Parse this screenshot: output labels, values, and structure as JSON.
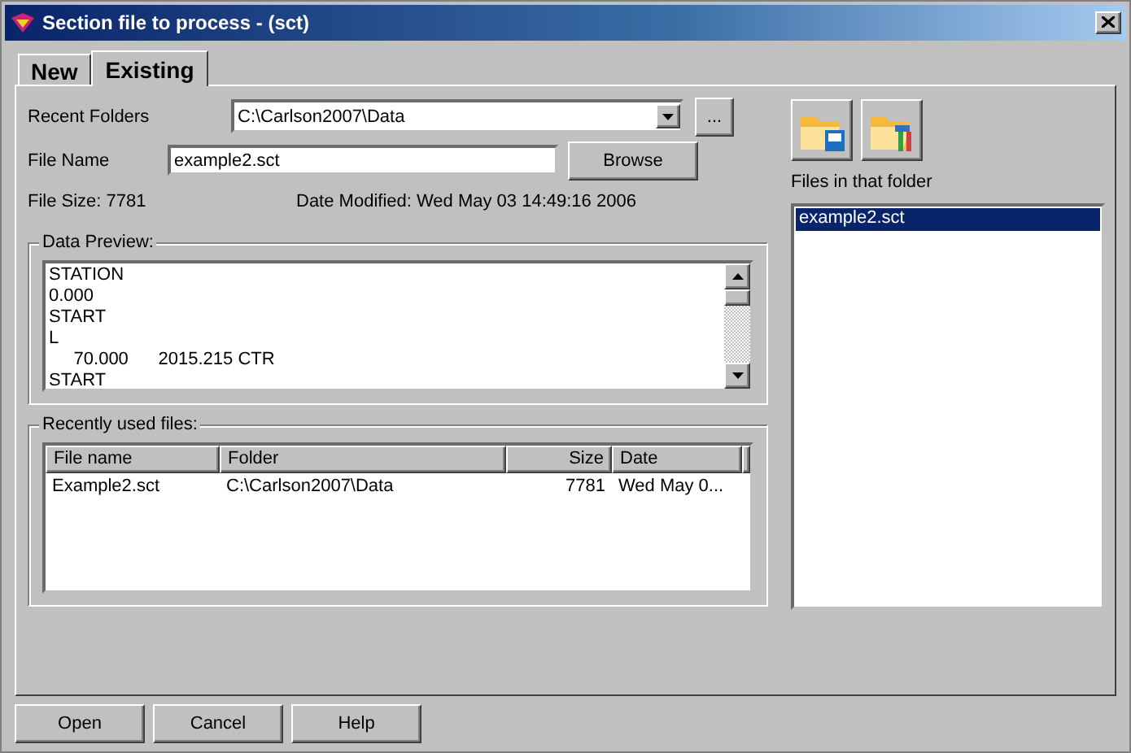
{
  "window": {
    "title": "Section file to process - (sct)"
  },
  "tabs": [
    {
      "label": "New",
      "selected": false
    },
    {
      "label": "Existing",
      "selected": true
    }
  ],
  "recent_folders": {
    "label": "Recent Folders",
    "value": "C:\\Carlson2007\\Data",
    "browse_button": "..."
  },
  "file_name": {
    "label": "File Name",
    "value": "example2.sct",
    "browse_button": "Browse"
  },
  "file_size": "File Size: 7781",
  "date_modified": "Date Modified: Wed May 03 14:49:16 2006",
  "data_preview": {
    "title": "Data Preview:",
    "lines": [
      "STATION",
      "0.000",
      "START",
      "L",
      "     70.000      2015.215 CTR",
      "START"
    ]
  },
  "recent_files": {
    "title": "Recently used files:",
    "columns": [
      "File name",
      "Folder",
      "Size",
      "Date"
    ],
    "rows": [
      {
        "cells": [
          "Example2.sct",
          "C:\\Carlson2007\\Data",
          "7781",
          "Wed May 0..."
        ],
        "selected": false
      }
    ]
  },
  "folder_files": {
    "label": "Files in that folder",
    "items": [
      {
        "name": "example2.sct",
        "selected": true
      }
    ]
  },
  "buttons": [
    "Open",
    "Cancel",
    "Help"
  ]
}
